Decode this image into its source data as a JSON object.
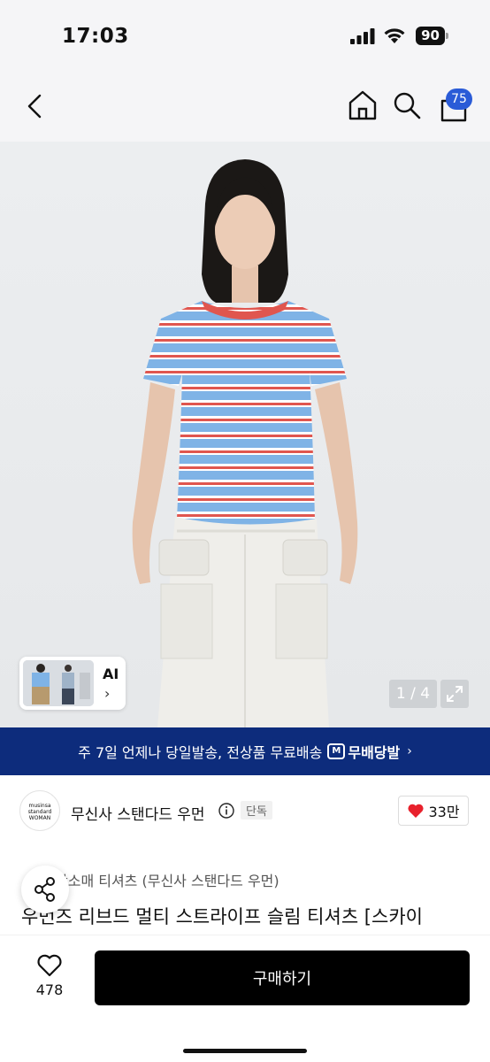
{
  "status_bar": {
    "time": "17:03",
    "battery": "90",
    "icons": [
      "signal-icon",
      "wifi-icon",
      "battery-icon"
    ]
  },
  "nav": {
    "icons": [
      "back-icon",
      "home-icon",
      "search-icon",
      "cart-icon"
    ],
    "cart_badge": "75"
  },
  "hero": {
    "ai_label": "AI",
    "ai_chevron": "›",
    "page_indicator": "1 / 4",
    "colors": {
      "stripe_blue": "#7fb3e6",
      "stripe_red": "#e0564f",
      "skirt": "#efeeea"
    }
  },
  "shipping_banner": {
    "text": "주 7일 언제나 당일발송, 전상품 무료배송",
    "logo_mark": "M",
    "logo_text": "무배당발",
    "chevron": "›",
    "background": "#0d2c7c"
  },
  "brand": {
    "logo_text": "musinsa standard WOMAN",
    "name": "무신사 스탠다드 우먼",
    "exclusive_badge": "단독",
    "like_count": "33만"
  },
  "product": {
    "category": "반소매 티셔츠 (무신사 스탠다드 우먼)",
    "title": "우먼즈 리브드 멀티 스트라이프 슬림 티셔츠 [스카이"
  },
  "bottom_bar": {
    "wish_count": "478",
    "buy_label": "구매하기"
  }
}
